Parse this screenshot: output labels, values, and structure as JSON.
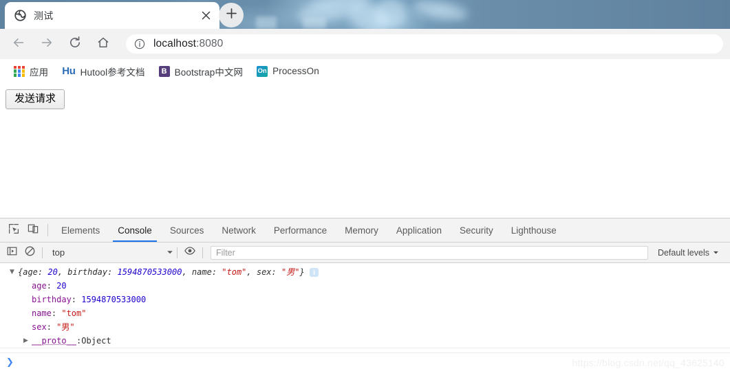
{
  "browser": {
    "tab": {
      "title": "测试",
      "favicon_icon": "globe-icon",
      "close_icon": "close-icon"
    },
    "new_tab_icon": "plus-icon",
    "toolbar": {
      "back_icon": "arrow-left-icon",
      "forward_icon": "arrow-right-icon",
      "reload_icon": "reload-icon",
      "home_icon": "home-icon",
      "omnibox": {
        "info_icon": "info-circle-icon",
        "host": "localhost",
        "port": ":8080",
        "full_url": "localhost:8080"
      }
    },
    "bookmarks": [
      {
        "label": "应用",
        "icon": "apps-grid-icon",
        "icon_kind": "grid"
      },
      {
        "label": "Hutool参考文档",
        "icon": "hutool-icon",
        "icon_kind": "text",
        "icon_text": "Hu",
        "icon_color": "#2b6cb8"
      },
      {
        "label": "Bootstrap中文网",
        "icon": "bootstrap-icon",
        "icon_kind": "square",
        "icon_text": "B",
        "icon_color": "#563d7c"
      },
      {
        "label": "ProcessOn",
        "icon": "processon-icon",
        "icon_kind": "square",
        "icon_text": "On",
        "icon_color": "#0d7fc4"
      }
    ]
  },
  "page": {
    "send_request_button": "发送请求"
  },
  "devtools": {
    "inspect_icon": "inspect-element-icon",
    "device_toolbar_icon": "device-toolbar-icon",
    "tabs": [
      {
        "label": "Elements",
        "active": false
      },
      {
        "label": "Console",
        "active": true
      },
      {
        "label": "Sources",
        "active": false
      },
      {
        "label": "Network",
        "active": false
      },
      {
        "label": "Performance",
        "active": false
      },
      {
        "label": "Memory",
        "active": false
      },
      {
        "label": "Application",
        "active": false
      },
      {
        "label": "Security",
        "active": false
      },
      {
        "label": "Lighthouse",
        "active": false
      }
    ],
    "active_tab_underline_color": "#1a73e8",
    "filterbar": {
      "sidebar_icon": "console-sidebar-icon",
      "clear_icon": "clear-console-icon",
      "context": "top",
      "context_chevron_icon": "chevron-down-icon",
      "eye_icon": "eye-icon",
      "filter_placeholder": "Filter",
      "levels_label": "Default levels",
      "levels_chevron_icon": "chevron-down-icon"
    },
    "console": {
      "message": {
        "expanded": true,
        "disclosure_open_icon": "triangle-down-icon",
        "preview": {
          "open_brace": "{",
          "close_brace": "}",
          "parts": [
            {
              "key": "age",
              "sep": ": ",
              "value": "20",
              "value_type": "number",
              "trail": ", "
            },
            {
              "key": "birthday",
              "sep": ": ",
              "value": "1594870533000",
              "value_type": "number",
              "trail": ", "
            },
            {
              "key": "name",
              "sep": ": ",
              "value": "\"tom\"",
              "value_type": "string",
              "trail": ", "
            },
            {
              "key": "sex",
              "sep": ": ",
              "value": "\"男\"",
              "value_type": "string",
              "trail": ""
            }
          ]
        },
        "info_badge_icon": "info-icon",
        "properties": [
          {
            "key": "age",
            "value": "20",
            "value_type": "number"
          },
          {
            "key": "birthday",
            "value": "1594870533000",
            "value_type": "number"
          },
          {
            "key": "name",
            "value": "\"tom\"",
            "value_type": "string"
          },
          {
            "key": "sex",
            "value": "\"男\"",
            "value_type": "string"
          }
        ],
        "proto": {
          "disclosure_closed_icon": "triangle-right-icon",
          "key": "__proto__",
          "sep": ": ",
          "value": "Object"
        }
      },
      "prompt_icon": "prompt-chevron-icon"
    }
  },
  "watermark": "https://blog.csdn.net/qq_43625140",
  "colors": {
    "accent_blue": "#1a73e8",
    "tabstrip_blue": "#6389a6",
    "token_number": "#1c00cf",
    "token_string": "#c41a16",
    "token_property": "#881391"
  }
}
